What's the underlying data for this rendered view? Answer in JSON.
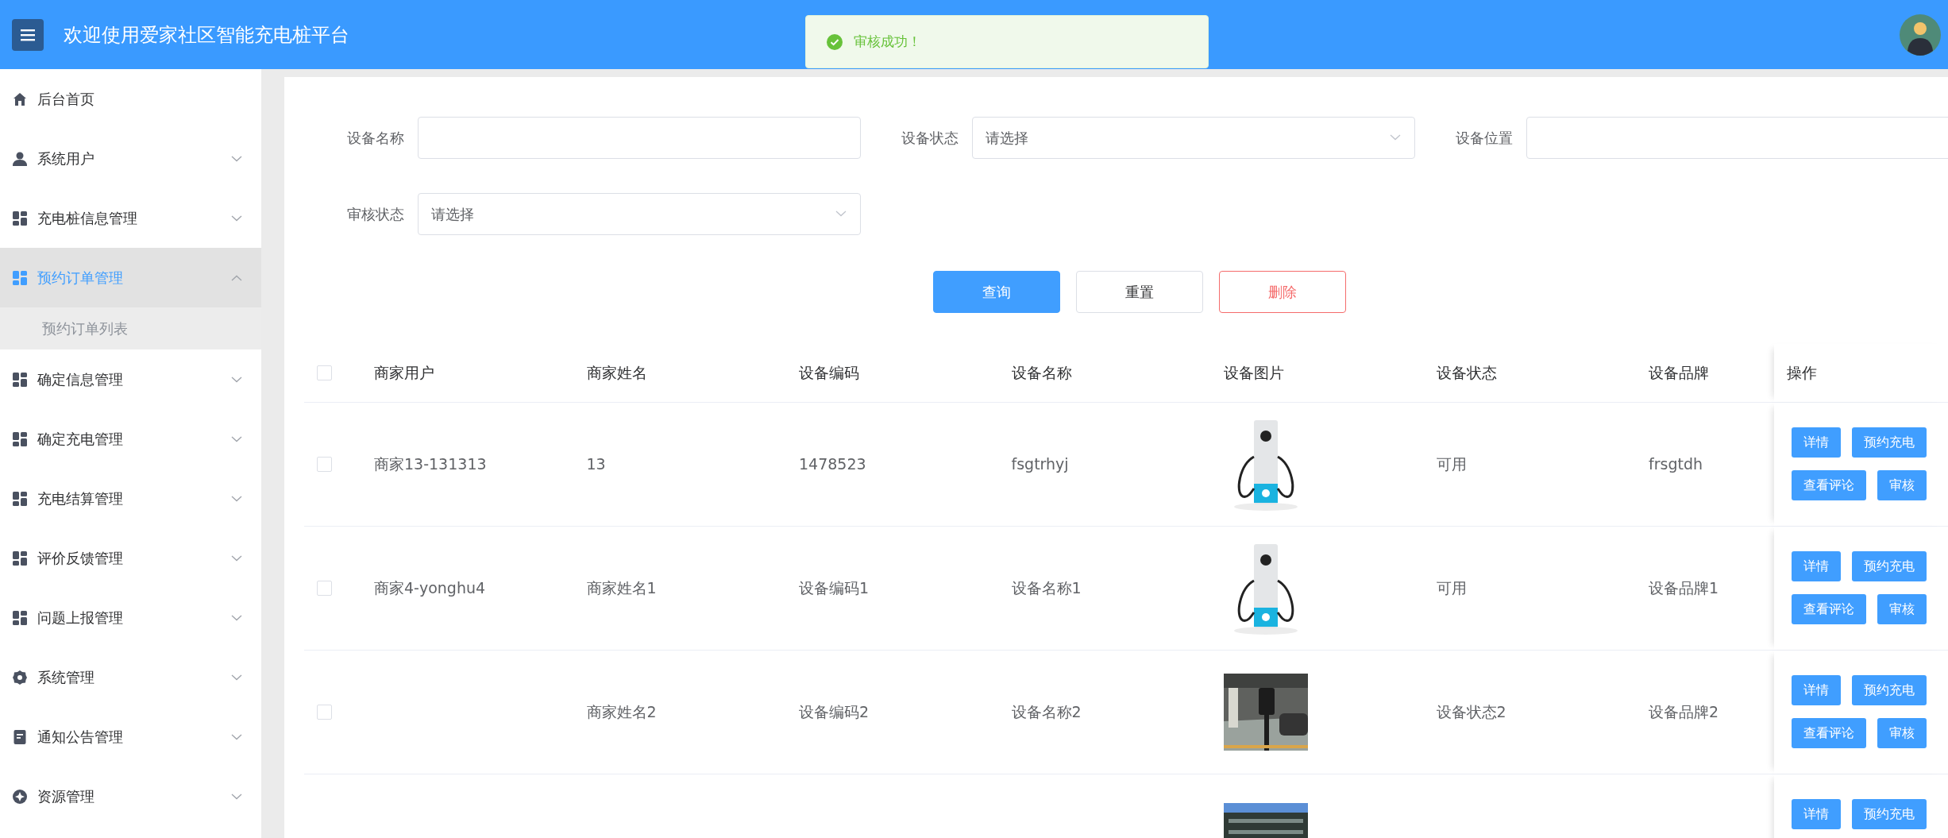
{
  "header": {
    "title": "欢迎使用爱家社区智能充电桩平台"
  },
  "toast": {
    "kind": "success",
    "message": "审核成功！"
  },
  "sidebar": {
    "items": [
      {
        "label": "后台首页",
        "kind": "link",
        "selected": false
      },
      {
        "label": "系统用户",
        "kind": "group",
        "selected": false,
        "expanded": false
      },
      {
        "label": "充电桩信息管理",
        "kind": "group",
        "selected": false,
        "expanded": false
      },
      {
        "label": "预约订单管理",
        "kind": "group",
        "selected": true,
        "expanded": true,
        "children": [
          {
            "label": "预约订单列表",
            "selected": false
          }
        ]
      },
      {
        "label": "确定信息管理",
        "kind": "group",
        "selected": false,
        "expanded": false
      },
      {
        "label": "确定充电管理",
        "kind": "group",
        "selected": false,
        "expanded": false
      },
      {
        "label": "充电结算管理",
        "kind": "group",
        "selected": false,
        "expanded": false
      },
      {
        "label": "评价反馈管理",
        "kind": "group",
        "selected": false,
        "expanded": false
      },
      {
        "label": "问题上报管理",
        "kind": "group",
        "selected": false,
        "expanded": false
      },
      {
        "label": "系统管理",
        "kind": "group",
        "selected": false,
        "expanded": false
      },
      {
        "label": "通知公告管理",
        "kind": "group",
        "selected": false,
        "expanded": false
      },
      {
        "label": "资源管理",
        "kind": "group",
        "selected": false,
        "expanded": false
      }
    ]
  },
  "filters": [
    {
      "label": "设备名称",
      "kind": "text"
    },
    {
      "label": "设备状态",
      "kind": "select",
      "placeholder": "请选择"
    },
    {
      "label": "设备位置",
      "kind": "text"
    },
    {
      "label": "审核状态",
      "kind": "select",
      "placeholder": "请选择"
    }
  ],
  "actions": [
    {
      "label": "查询",
      "kind": "primary"
    },
    {
      "label": "重置",
      "kind": "default"
    },
    {
      "label": "删除",
      "kind": "danger"
    }
  ],
  "table": {
    "select_all": {
      "checked": false
    },
    "columns": [
      "商家用户",
      "商家姓名",
      "设备编码",
      "设备名称",
      "设备图片",
      "设备状态",
      "设备品牌",
      "操作"
    ],
    "rows": [
      {
        "checked": false,
        "cells": [
          "商家13-131313",
          "13",
          "1478523",
          "fsgtrhyj",
          {
            "kind": "picture"
          },
          "可用",
          "frsgtdh"
        ],
        "actions": [
          "详情",
          "预约充电",
          "查看评论",
          "审核"
        ]
      },
      {
        "checked": false,
        "cells": [
          "商家4-yonghu4",
          "商家姓名1",
          "设备编码1",
          "设备名称1",
          {
            "kind": "picture"
          },
          "可用",
          "设备品牌1"
        ],
        "actions": [
          "详情",
          "预约充电",
          "查看评论",
          "审核"
        ]
      },
      {
        "checked": false,
        "cells": [
          null,
          "商家姓名2",
          "设备编码2",
          "设备名称2",
          {
            "kind": "picture"
          },
          "设备状态2",
          "设备品牌2"
        ],
        "actions": [
          "详情",
          "预约充电",
          "查看评论",
          "审核"
        ]
      },
      {
        "cells": [
          null,
          null,
          null,
          null,
          {
            "kind": "picture"
          },
          null,
          null
        ],
        "actions": [
          "详情",
          "预约充电"
        ]
      }
    ]
  }
}
